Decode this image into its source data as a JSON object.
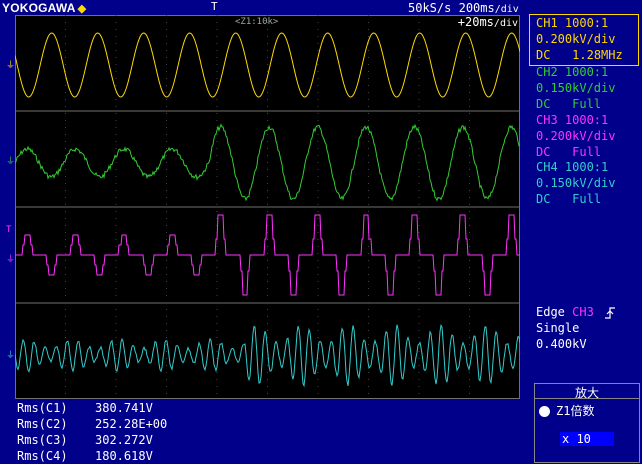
{
  "header": {
    "brand": "YOKOGAWA",
    "brand_mark": "◆",
    "trigger_marker": "T",
    "sample_rate": "50kS/s",
    "record_length": "200ms",
    "record_unit": "div"
  },
  "screen": {
    "zoom_label": "<Z1:10k>",
    "time_div": "+20ms",
    "time_div_unit": "div",
    "ground_marker": "⏚"
  },
  "channels": [
    {
      "name": "CH1 1000:1",
      "scale": "0.200kV/div",
      "coupling": "DC",
      "bw": "1.28MHz",
      "color": "#ffd800"
    },
    {
      "name": "CH2 1000:1",
      "scale": "0.150kV/div",
      "coupling": "DC",
      "bw": "Full",
      "color": "#33cc33"
    },
    {
      "name": "CH3 1000:1",
      "scale": "0.200kV/div",
      "coupling": "DC",
      "bw": "Full",
      "color": "#ff33ff"
    },
    {
      "name": "CH4 1000:1",
      "scale": "0.150kV/div",
      "coupling": "DC",
      "bw": "Full",
      "color": "#33cccc"
    }
  ],
  "trigger": {
    "type": "Edge",
    "source": "CH3",
    "slope_icon": "rising-edge-icon",
    "mode": "Single",
    "level": "0.400kV"
  },
  "zoom": {
    "title": "放大",
    "item": "Z1倍数",
    "value": "x 10"
  },
  "measurements": [
    {
      "label": "Rms(C1)",
      "value": "380.741V"
    },
    {
      "label": "Rms(C2)",
      "value": "252.28E+00"
    },
    {
      "label": "Rms(C3)",
      "value": "302.272V"
    },
    {
      "label": "Rms(C4)",
      "value": "180.618V"
    }
  ],
  "colors": {
    "background": "#00008a",
    "screen": "#000000",
    "grid": "#707070",
    "ch1": "#ffd800",
    "ch2": "#33cc33",
    "ch3": "#ff33ff",
    "ch4": "#33cccc",
    "highlight": "#0000ff"
  }
}
